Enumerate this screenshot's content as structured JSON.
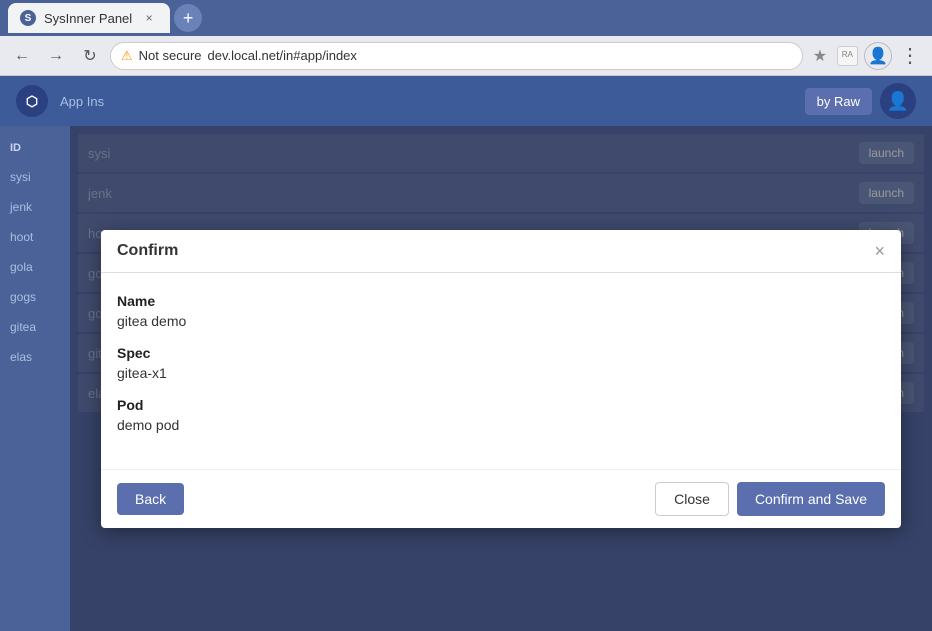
{
  "browser": {
    "tab_title": "SysInner Panel",
    "tab_favicon": "S",
    "tab_close_icon": "×",
    "new_tab_icon": "+",
    "back_icon": "←",
    "forward_icon": "→",
    "refresh_icon": "↻",
    "address_not_secure": "Not secure",
    "address_url": "dev.local.net/in#app/index",
    "bookmark_icon": "★",
    "reader_icon": "ᴿᴬ",
    "profile_icon": "👤",
    "more_icon": "⋮"
  },
  "app": {
    "logo_text": "⬡",
    "nav_label": "App Ins",
    "view_raw_label": "by Raw",
    "user_icon": "👤"
  },
  "sidebar": {
    "items": [
      {
        "id": "sysi",
        "label": "sysi"
      },
      {
        "id": "jenk",
        "label": "jenk"
      },
      {
        "id": "hoot",
        "label": "hoot"
      },
      {
        "id": "gola",
        "label": "gola"
      },
      {
        "id": "gogs",
        "label": "gogs"
      },
      {
        "id": "gitea",
        "label": "gitea"
      },
      {
        "id": "elas",
        "label": "elas"
      }
    ]
  },
  "table": {
    "rows": [
      {
        "id": "sysi",
        "launch": "launch"
      },
      {
        "id": "jenk",
        "launch": "launch"
      },
      {
        "id": "hoot",
        "launch": "launch"
      },
      {
        "id": "gola",
        "launch": "launch"
      },
      {
        "id": "gogs",
        "launch": "launch"
      },
      {
        "id": "gitea",
        "launch": "launch"
      },
      {
        "id": "elas",
        "launch": "launch"
      }
    ]
  },
  "modal": {
    "title": "Confirm",
    "close_icon": "×",
    "fields": [
      {
        "label": "Name",
        "value": "gitea demo"
      },
      {
        "label": "Spec",
        "value": "gitea-x1"
      },
      {
        "label": "Pod",
        "value": "demo pod"
      }
    ],
    "back_button": "Back",
    "close_button": "Close",
    "confirm_button": "Confirm and Save"
  }
}
